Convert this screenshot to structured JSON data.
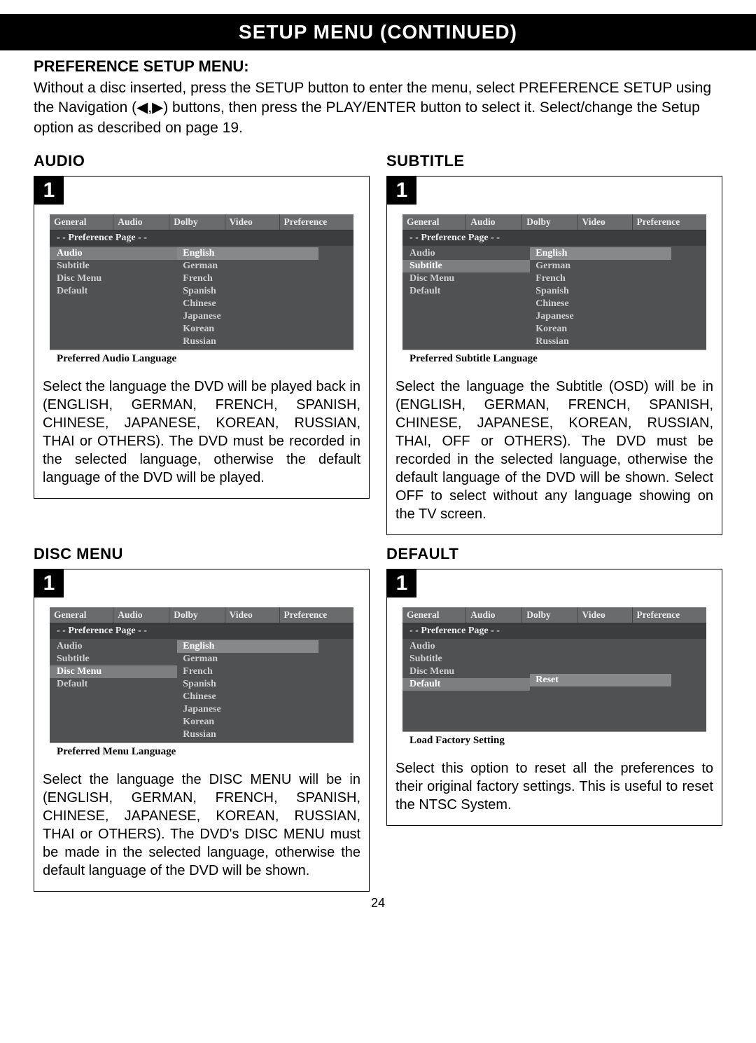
{
  "title_bar": "SETUP MENU (CONTINUED)",
  "intro": {
    "heading": "PREFERENCE SETUP MENU:",
    "text": "Without a disc inserted, press the SETUP button to enter the menu, select PREFERENCE SETUP using the Navigation (◀,▶) buttons, then press the PLAY/ENTER button to select it. Select/change the Setup option as described on page 19."
  },
  "osd_common": {
    "tabs": [
      "General",
      "Audio",
      "Dolby",
      "Video",
      "Preference"
    ],
    "subhead": "- - Preference Page - -",
    "left_items": [
      "Audio",
      "Subtitle",
      "Disc Menu",
      "Default"
    ],
    "lang_opts": [
      "English",
      "German",
      "French",
      "Spanish",
      "Chinese",
      "Japanese",
      "Korean",
      "Russian"
    ]
  },
  "sections": {
    "audio": {
      "heading": "AUDIO",
      "step": "1",
      "selected_left": "Audio",
      "selected_opt": "English",
      "footer": "Preferred Audio Language",
      "desc": "Select the language the DVD will be played back in (ENGLISH, GERMAN, FRENCH, SPANISH, CHINESE, JAPANESE, KOREAN, RUSSIAN, THAI or OTHERS). The DVD must be recorded in the selected language, otherwise the default language of the DVD will be played."
    },
    "subtitle": {
      "heading": "SUBTITLE",
      "step": "1",
      "selected_left": "Subtitle",
      "selected_opt": "English",
      "footer": "Preferred Subtitle Language",
      "desc": "Select the language the Subtitle (OSD) will be in (ENGLISH, GERMAN, FRENCH, SPANISH, CHINESE, JAPANESE, KOREAN, RUSSIAN, THAI, OFF or OTHERS). The DVD must be recorded in the selected language, otherwise the default language of the DVD will be shown. Select OFF to select without any language showing on the TV screen."
    },
    "discmenu": {
      "heading": "DISC MENU",
      "step": "1",
      "selected_left": "Disc Menu",
      "selected_opt": "English",
      "footer": "Preferred Menu Language",
      "desc": "Select the language the DISC MENU will be in (ENGLISH, GERMAN, FRENCH, SPANISH, CHINESE, JAPANESE, KOREAN, RUSSIAN, THAI or OTHERS). The DVD's DISC MENU must be made in the selected language, otherwise the default language of the DVD will be shown."
    },
    "default": {
      "heading": "DEFAULT",
      "step": "1",
      "selected_left": "Default",
      "right_opts": [
        "Reset"
      ],
      "selected_opt": "Reset",
      "footer": "Load Factory Setting",
      "desc": "Select this option to reset all the preferences to their original factory settings. This is useful to reset the NTSC System."
    }
  },
  "page_number": "24"
}
